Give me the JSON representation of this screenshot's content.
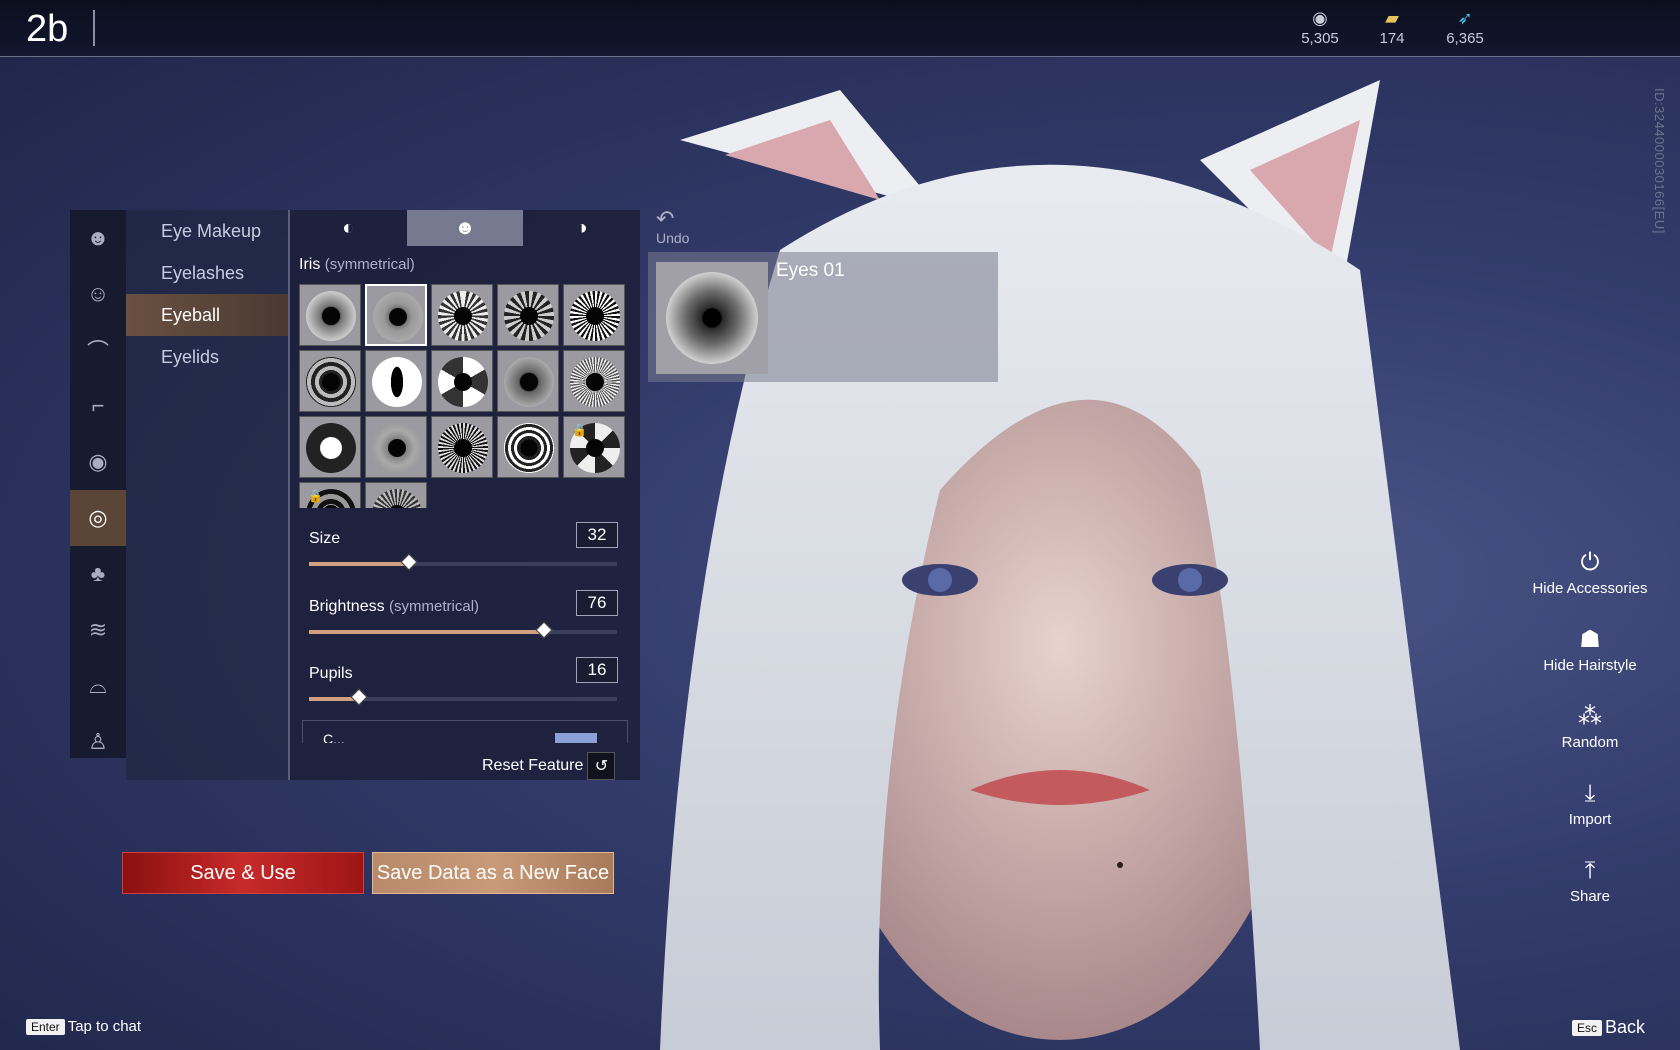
{
  "header": {
    "title": "2b",
    "currencies": [
      {
        "icon": "coin-icon",
        "value": "5,305",
        "color": "#c9ccd8"
      },
      {
        "icon": "ticket-icon",
        "value": "174",
        "color": "#e7c45b"
      },
      {
        "icon": "feather-icon",
        "value": "6,365",
        "color": "#4ac0e0"
      }
    ]
  },
  "player_id": "ID:3244000030166[EU]",
  "categories": [
    {
      "icon": "head-icon"
    },
    {
      "icon": "face-icon"
    },
    {
      "icon": "eyebrow-icon"
    },
    {
      "icon": "brow-shape-icon"
    },
    {
      "icon": "eye-icon"
    },
    {
      "icon": "eye-makeup-icon",
      "active": true
    },
    {
      "icon": "nose-icon"
    },
    {
      "icon": "lips-icon"
    },
    {
      "icon": "mouth-icon"
    },
    {
      "icon": "body-icon"
    }
  ],
  "subcategories": {
    "items": [
      {
        "label": "Eye Makeup"
      },
      {
        "label": "Eyelashes"
      },
      {
        "label": "Eyeball",
        "active": true
      },
      {
        "label": "Eyelids"
      }
    ]
  },
  "tabs": [
    {
      "icon": "left-side-icon"
    },
    {
      "icon": "both-sides-icon",
      "active": true
    },
    {
      "icon": "right-side-icon"
    }
  ],
  "iris": {
    "label": "Iris",
    "qualifier": "(symmetrical)",
    "selected_index": 1,
    "locked_indices": [
      14,
      15
    ],
    "count": 17
  },
  "sliders": [
    {
      "label": "Size",
      "qualifier": "",
      "value": "32",
      "fraction": 0.32
    },
    {
      "label": "Brightness",
      "qualifier": "(symmetrical)",
      "value": "76",
      "fraction": 0.76
    },
    {
      "label": "Pupils",
      "qualifier": "",
      "value": "16",
      "fraction": 0.16
    }
  ],
  "color_row": {
    "label": "C...",
    "swatch_color": "#8aa0d6"
  },
  "reset_label": "Reset Feature",
  "undo_label": "Undo",
  "preview": {
    "name": "Eyes 01"
  },
  "buttons": {
    "save_use": "Save & Use",
    "save_new": "Save Data as a New Face"
  },
  "actions": [
    {
      "icon": "accessory-icon",
      "label": "Hide Accessories"
    },
    {
      "icon": "hairstyle-icon",
      "label": "Hide Hairstyle"
    },
    {
      "icon": "random-icon",
      "label": "Random"
    },
    {
      "icon": "import-icon",
      "label": "Import"
    },
    {
      "icon": "share-icon",
      "label": "Share"
    }
  ],
  "footer": {
    "chat_key": "Enter",
    "chat_label": "Tap to chat",
    "back_key": "Esc",
    "back_label": "Back"
  }
}
